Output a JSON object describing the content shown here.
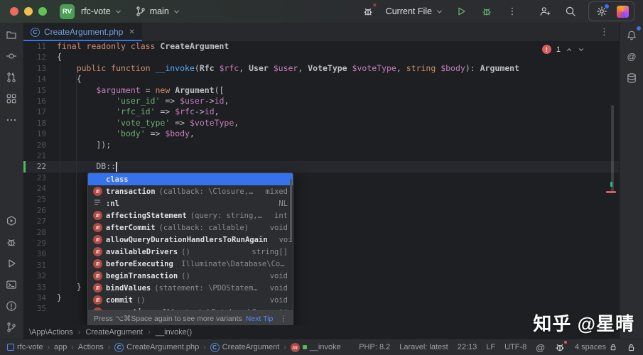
{
  "colors": {
    "chrome": "#2b2d30",
    "editor_bg": "#1e1f22",
    "accent_blue": "#3574f0",
    "link_blue": "#548af7",
    "selection_blue": "#3672ec",
    "error_red": "#db5c5c",
    "vcs_green": "#57b55c",
    "keyword": "#cf8e6d",
    "string": "#6aab73",
    "variable": "#c77dbb",
    "method": "#56a8f5",
    "default_text": "#bcbec4",
    "tab_label_blue": "#6f9fe0",
    "project_badge_green": "#4d9d57"
  },
  "title_bar": {
    "traffic_lights": [
      "#ec6a5e",
      "#f4bf4f",
      "#61c454"
    ],
    "project_badge": "RV",
    "project_name": "rfc-vote",
    "branch_name": "main",
    "run_config": "Current File",
    "right_icon_names": [
      "no-inspections-icon",
      "run-icon",
      "debug-icon",
      "more-vertical-icon",
      "code-with-me-icon",
      "search-icon",
      "settings-icon",
      "ide-logo-icon"
    ]
  },
  "tab_bar": {
    "tabs": [
      {
        "label": "CreateArgument.php",
        "icon": "class-icon",
        "close_glyph": "✕",
        "active": true
      }
    ],
    "more_glyph": "⋮"
  },
  "left_sidebar": {
    "top": [
      "project-folder-icon",
      "commit-icon",
      "pull-requests-icon",
      "structure-icon",
      "more-horizontal-icon"
    ],
    "bottom": [
      "services-icon",
      "debug-tool-icon",
      "run-tool-icon",
      "terminal-icon",
      "problems-icon",
      "git-branch-icon"
    ]
  },
  "right_sidebar": {
    "items": [
      {
        "icon": "notifications-icon",
        "badge": true
      },
      {
        "icon": "at-icon",
        "badge": false
      },
      {
        "icon": "database-icon",
        "badge": false
      }
    ]
  },
  "editor": {
    "first_line": 11,
    "caret_line": 22,
    "error_widget": {
      "count": "1"
    },
    "lines": [
      [
        [
          "kw",
          "final readonly class "
        ],
        [
          "cl",
          "CreateArgument"
        ]
      ],
      [
        [
          "df",
          "{"
        ]
      ],
      [
        [
          "df",
          "    "
        ],
        [
          "kw",
          "public function "
        ],
        [
          "fn",
          "__invoke"
        ],
        [
          "df",
          "("
        ],
        [
          "cl",
          "Rfc"
        ],
        [
          "df",
          " "
        ],
        [
          "va",
          "$rfc"
        ],
        [
          "df",
          ", "
        ],
        [
          "cl",
          "User"
        ],
        [
          "df",
          " "
        ],
        [
          "va",
          "$user"
        ],
        [
          "df",
          ", "
        ],
        [
          "cl",
          "VoteType"
        ],
        [
          "df",
          " "
        ],
        [
          "va",
          "$voteType"
        ],
        [
          "df",
          ", "
        ],
        [
          "kw",
          "string"
        ],
        [
          "df",
          " "
        ],
        [
          "va",
          "$body"
        ],
        [
          "df",
          "): "
        ],
        [
          "cl",
          "Argument"
        ]
      ],
      [
        [
          "df",
          "    {"
        ]
      ],
      [
        [
          "df",
          "        "
        ],
        [
          "va",
          "$argument"
        ],
        [
          "df",
          " = "
        ],
        [
          "kw",
          "new"
        ],
        [
          "df",
          " "
        ],
        [
          "cl",
          "Argument"
        ],
        [
          "df",
          "(["
        ]
      ],
      [
        [
          "df",
          "            "
        ],
        [
          "st",
          "'user_id'"
        ],
        [
          "df",
          " => "
        ],
        [
          "va",
          "$user"
        ],
        [
          "df",
          "->"
        ],
        [
          "pr",
          "id"
        ],
        [
          "df",
          ","
        ]
      ],
      [
        [
          "df",
          "            "
        ],
        [
          "st",
          "'rfc_id'"
        ],
        [
          "df",
          " => "
        ],
        [
          "va",
          "$rfc"
        ],
        [
          "df",
          "->"
        ],
        [
          "pr",
          "id"
        ],
        [
          "df",
          ","
        ]
      ],
      [
        [
          "df",
          "            "
        ],
        [
          "st",
          "'vote_type'"
        ],
        [
          "df",
          " => "
        ],
        [
          "va",
          "$voteType"
        ],
        [
          "df",
          ","
        ]
      ],
      [
        [
          "df",
          "            "
        ],
        [
          "st",
          "'body'"
        ],
        [
          "df",
          " => "
        ],
        [
          "va",
          "$body"
        ],
        [
          "df",
          ","
        ]
      ],
      [
        [
          "df",
          "        ]);"
        ]
      ],
      [],
      [
        [
          "df",
          "        DB::"
        ]
      ],
      [],
      [],
      [],
      [],
      [],
      [],
      [],
      [],
      [],
      [],
      [
        [
          "df",
          "    }"
        ]
      ],
      [
        [
          "df",
          "}"
        ]
      ],
      []
    ]
  },
  "completion": {
    "items": [
      {
        "kind": "keyword",
        "name": "class",
        "params": "",
        "type": "",
        "selected": true
      },
      {
        "kind": "method",
        "name": "transaction",
        "params": "(callback: \\Closure, [attem…",
        "type": "mixed"
      },
      {
        "kind": "template",
        "name": ":nl",
        "params": "",
        "type": "NL"
      },
      {
        "kind": "method",
        "name": "affectingStatement",
        "params": "(query: string, [bindi…",
        "type": "int"
      },
      {
        "kind": "method",
        "name": "afterCommit",
        "params": "(callback: callable)",
        "type": "void"
      },
      {
        "kind": "method",
        "name": "allowQueryDurationHandlersToRunAgain",
        "params": "()",
        "type": "void"
      },
      {
        "kind": "method",
        "name": "availableDrivers",
        "params": "()",
        "type": "string[]"
      },
      {
        "kind": "method",
        "name": "beforeExecuting",
        "params": " Illuminate\\Database\\Connecti…",
        "type": ""
      },
      {
        "kind": "method",
        "name": "beginTransaction",
        "params": "()",
        "type": "void"
      },
      {
        "kind": "method",
        "name": "bindValues",
        "params": "(statement: \\PDOStatement, bi…",
        "type": "void"
      },
      {
        "kind": "method",
        "name": "commit",
        "params": "()",
        "type": "void"
      },
      {
        "kind": "method",
        "name": "connection",
        "params": "([n…",
        "type": "Illuminate\\Database\\Connection"
      }
    ],
    "footer_hint": "Press ⌥⌘Space again to see more variants",
    "footer_link": "Next Tip",
    "footer_more_glyph": "⋮"
  },
  "breadcrumbs": [
    "\\App\\Actions",
    "CreateArgument",
    "__invoke()"
  ],
  "status_bar": {
    "nav": [
      {
        "icon": "project-icon",
        "label": "rfc-vote"
      },
      {
        "icon": "",
        "label": "app"
      },
      {
        "icon": "",
        "label": "Actions"
      },
      {
        "icon": "class-icon",
        "label": "CreateArgument.php"
      },
      {
        "icon": "class-icon",
        "label": "CreateArgument"
      },
      {
        "icon": "method-icon",
        "green_dot": true,
        "label": "__invoke"
      }
    ],
    "right": [
      {
        "label": "PHP: 8.2"
      },
      {
        "label": "Laravel: latest"
      },
      {
        "label": "22:13"
      },
      {
        "label": "LF"
      },
      {
        "label": "UTF-8"
      },
      {
        "icon": "at-icon"
      },
      {
        "icon": "inspections-icon"
      },
      {
        "label": "4 spaces",
        "icon": "indent-lock-icon"
      },
      {
        "icon": "unlock-icon"
      }
    ]
  },
  "watermark": "知乎 @星晴"
}
